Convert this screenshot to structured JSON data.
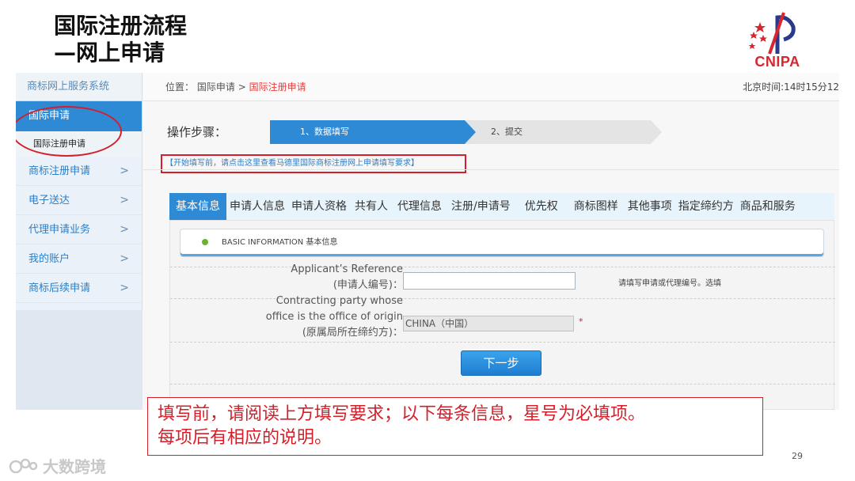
{
  "slide": {
    "title_line1": "国际注册流程",
    "title_line2": "—网上申请",
    "page_number": "29"
  },
  "logo": {
    "text": "CNIPA",
    "icon": "cnipa-logo-icon",
    "color": "#d8262f"
  },
  "sidebar": {
    "header": "商标网上服务系统",
    "active_item": "国际申请",
    "sub_item": "国际注册申请",
    "items": [
      {
        "label": "商标注册申请",
        "chevron": ">"
      },
      {
        "label": "电子送达",
        "chevron": ">"
      },
      {
        "label": "代理申请业务",
        "chevron": ">"
      },
      {
        "label": "我的账户",
        "chevron": ">"
      },
      {
        "label": "商标后续申请",
        "chevron": ">"
      }
    ]
  },
  "breadcrumb": {
    "prefix": "位置：",
    "parent": "国际申请",
    "separator": ">",
    "current": "国际注册申请"
  },
  "clock": "北京时间:14时15分12",
  "steps": {
    "label": "操作步骤：",
    "step1": "1、数据填写",
    "step2": "2、提交"
  },
  "notice": "【开始填写前，请点击这里查看马德里国际商标注册网上申请填写要求】",
  "tabs": [
    {
      "label": "基本信息",
      "active": true
    },
    {
      "label": "申请人信息",
      "active": false
    },
    {
      "label": "申请人资格",
      "active": false
    },
    {
      "label": "共有人",
      "active": false
    },
    {
      "label": "代理信息",
      "active": false
    },
    {
      "label": "注册/申请号",
      "active": false
    },
    {
      "label": "优先权",
      "active": false
    },
    {
      "label": "商标图样",
      "active": false
    },
    {
      "label": "其他事项",
      "active": false
    },
    {
      "label": "指定缔约方",
      "active": false
    },
    {
      "label": "商品和服务",
      "active": false
    }
  ],
  "form": {
    "section_title": "BASIC INFORMATION 基本信息",
    "ref_label_en": "Applicant’s Reference",
    "ref_label_cn": "(申请人编号)：",
    "ref_value": "",
    "ref_hint": "请填写申请或代理编号。选填",
    "party_label_en1": "Contracting party whose",
    "party_label_en2": "office is the office of origin",
    "party_label_cn": "(原属局所在缔约方)：",
    "party_value": "CHINA（中国）",
    "required_mark": "*",
    "next_button": "下一步"
  },
  "annotation": {
    "line1": "填写前，请阅读上方填写要求；以下每条信息，星号为必填项。",
    "line2": "每项后有相应的说明。"
  },
  "watermark": {
    "text": "大数跨境",
    "icon": "bubble-logo-icon"
  },
  "colors": {
    "accent_blue": "#2f8ad6",
    "annotation_red": "#d41f2a",
    "link_blue": "#2d7fc6"
  }
}
